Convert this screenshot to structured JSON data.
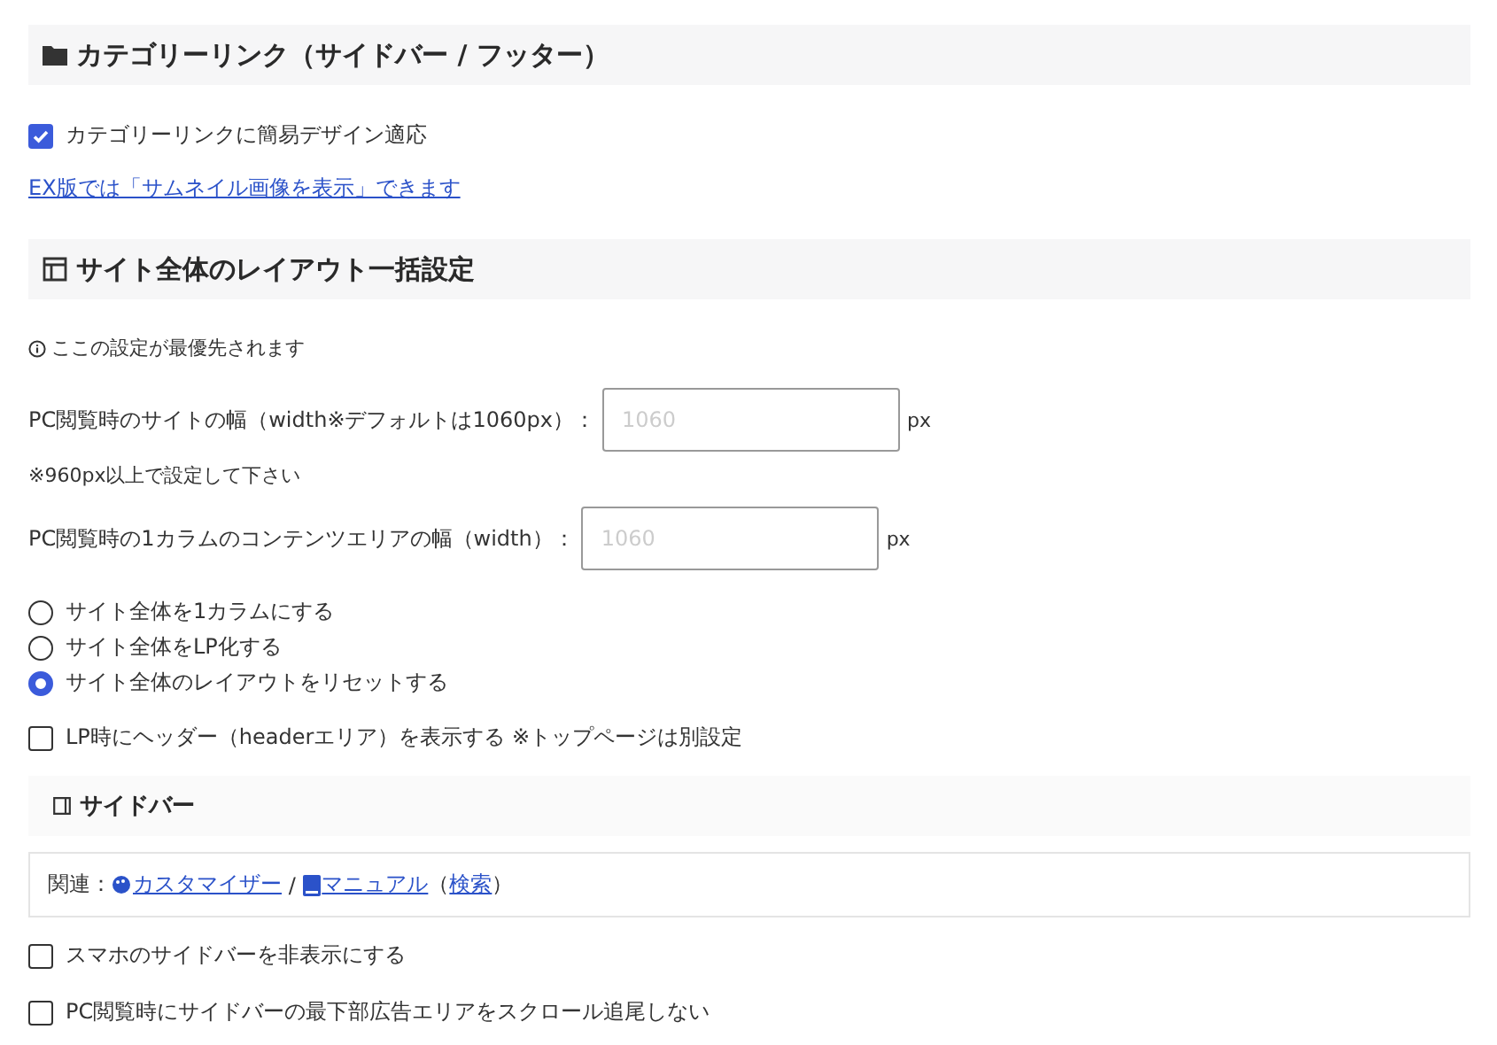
{
  "category_section": {
    "title": "カテゴリーリンク（サイドバー / フッター）",
    "checkbox": {
      "label": "カテゴリーリンクに簡易デザイン適応",
      "checked": true
    },
    "link": "EX版では「サムネイル画像を表示」できます"
  },
  "layout_section": {
    "title": "サイト全体のレイアウト一括設定",
    "notice": "ここの設定が最優先されます",
    "fields": [
      {
        "label": "PC閲覧時のサイトの幅（width※デフォルトは1060px）：",
        "placeholder": "1060",
        "unit": "px",
        "note": "※960px以上で設定して下さい"
      },
      {
        "label": "PC閲覧時の1カラムのコンテンツエリアの幅（width）：",
        "placeholder": "1060",
        "unit": "px"
      }
    ],
    "radios": [
      {
        "label": "サイト全体を1カラムにする",
        "selected": false
      },
      {
        "label": "サイト全体をLP化する",
        "selected": false
      },
      {
        "label": "サイト全体のレイアウトをリセットする",
        "selected": true
      }
    ],
    "checkbox": {
      "label": "LP時にヘッダー（headerエリア）を表示する ※トップページは別設定",
      "checked": false
    }
  },
  "sidebar_section": {
    "title": "サイドバー",
    "related": [
      {
        "kind": "text",
        "text": "関連："
      },
      {
        "kind": "palette-link",
        "text": "カスタマイザー"
      },
      {
        "kind": "text",
        "text": " / "
      },
      {
        "kind": "book-link",
        "text": "マニュアル"
      },
      {
        "kind": "text",
        "text": "（"
      },
      {
        "kind": "link",
        "text": "検索"
      },
      {
        "kind": "text",
        "text": "）"
      }
    ],
    "checkboxes": [
      {
        "label": "スマホのサイドバーを非表示にする",
        "checked": false
      },
      {
        "label": "PC閲覧時にサイドバーの最下部広告エリアをスクロール追尾しない",
        "checked": false
      }
    ]
  }
}
